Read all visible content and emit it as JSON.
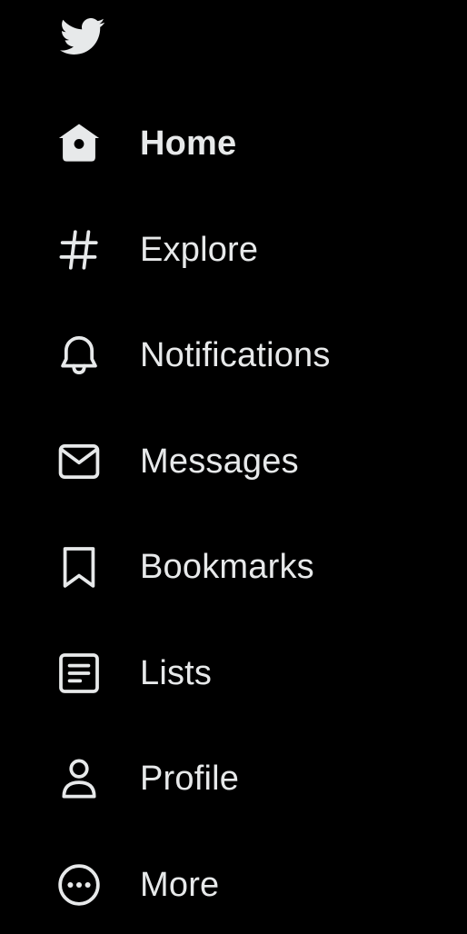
{
  "brand": {
    "logo_icon": "twitter-bird-icon",
    "logo_color": "#e7e9ea"
  },
  "theme": {
    "background": "#000000",
    "text": "#e7e9ea"
  },
  "nav": {
    "items": [
      {
        "label": "Home",
        "icon": "home-icon",
        "active": true
      },
      {
        "label": "Explore",
        "icon": "hashtag-icon",
        "active": false
      },
      {
        "label": "Notifications",
        "icon": "bell-icon",
        "active": false
      },
      {
        "label": "Messages",
        "icon": "envelope-icon",
        "active": false
      },
      {
        "label": "Bookmarks",
        "icon": "bookmark-icon",
        "active": false
      },
      {
        "label": "Lists",
        "icon": "list-icon",
        "active": false
      },
      {
        "label": "Profile",
        "icon": "person-icon",
        "active": false
      },
      {
        "label": "More",
        "icon": "more-circle-icon",
        "active": false
      }
    ]
  }
}
